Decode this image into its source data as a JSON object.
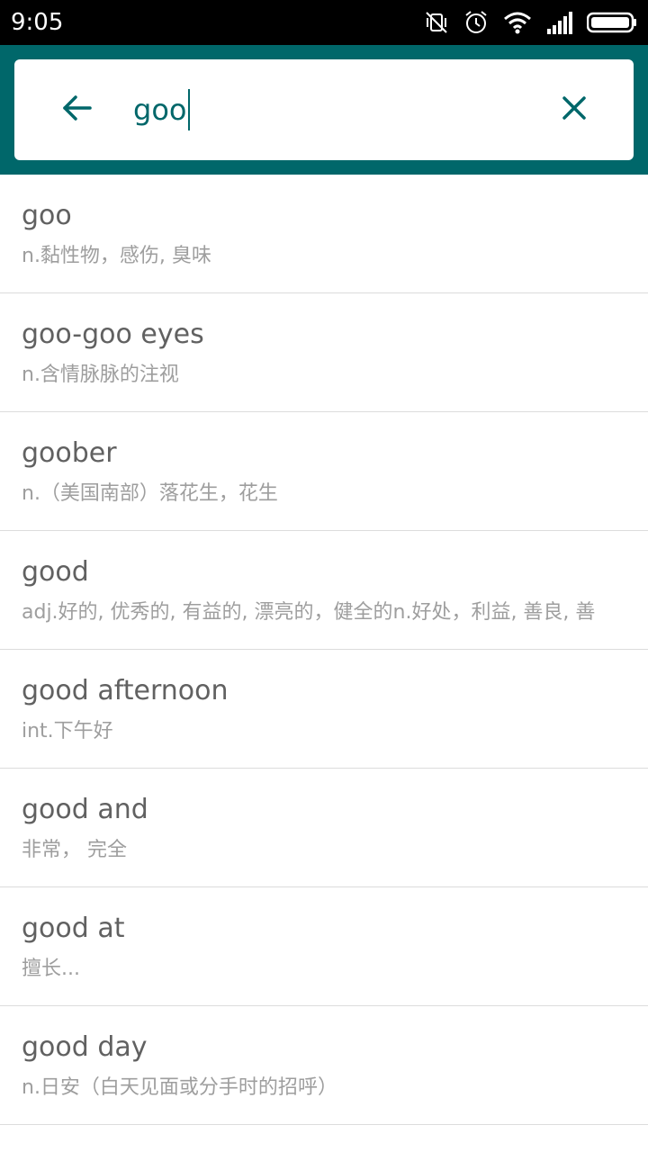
{
  "status_bar": {
    "time": "9:05",
    "icons": [
      "vibrate-off-icon",
      "alarm-icon",
      "wifi-icon",
      "signal-icon",
      "battery-icon"
    ]
  },
  "search": {
    "query": "goo",
    "back_icon": "arrow-left-icon",
    "clear_icon": "close-icon"
  },
  "colors": {
    "header": "#00676a",
    "accent": "#00676a",
    "word_text": "#616161",
    "def_text": "#9e9e9e",
    "divider": "#dcdcdc"
  },
  "results": [
    {
      "word": "goo",
      "definition": "n.黏性物，感伤, 臭味"
    },
    {
      "word": "goo-goo eyes",
      "definition": "n.含情脉脉的注视"
    },
    {
      "word": "goober",
      "definition": "n.（美国南部）落花生，花生"
    },
    {
      "word": "good",
      "definition": "adj.好的, 优秀的, 有益的, 漂亮的，健全的n.好处，利益, 善良, 善"
    },
    {
      "word": "good afternoon",
      "definition": "int.下午好"
    },
    {
      "word": "good and",
      "definition": "非常， 完全"
    },
    {
      "word": "good at",
      "definition": "擅长..."
    },
    {
      "word": "good day",
      "definition": "n.日安（白天见面或分手时的招呼）"
    }
  ]
}
